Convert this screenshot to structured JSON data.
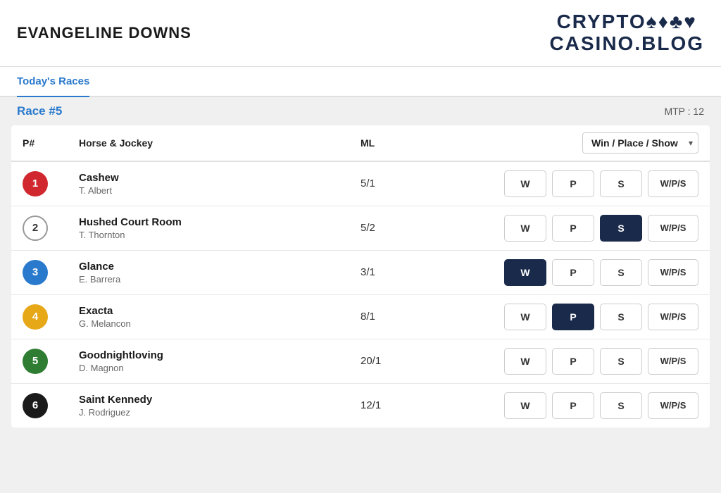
{
  "header": {
    "venue": "EVANGELINE DOWNS",
    "logo_line1": "CRYPTO♠♦♣♥",
    "logo_line2": "CASINO.BLOG"
  },
  "nav": {
    "today_races": "Today's Races"
  },
  "race": {
    "label": "Race #5",
    "mtp_label": "MTP : 12"
  },
  "table": {
    "col_p": "P#",
    "col_horse": "Horse & Jockey",
    "col_ml": "ML",
    "bet_type": "Win / Place / Show",
    "dropdown_chevron": "▾"
  },
  "horses": [
    {
      "number": "1",
      "color": "red",
      "outlined": false,
      "name": "Cashew",
      "jockey": "T. Albert",
      "ml": "5/1",
      "bets": [
        {
          "label": "W",
          "active": false
        },
        {
          "label": "P",
          "active": false
        },
        {
          "label": "S",
          "active": false
        },
        {
          "label": "W/P/S",
          "active": false
        }
      ]
    },
    {
      "number": "2",
      "color": "outlined",
      "outlined": true,
      "name": "Hushed Court Room",
      "jockey": "T. Thornton",
      "ml": "5/2",
      "bets": [
        {
          "label": "W",
          "active": false
        },
        {
          "label": "P",
          "active": false
        },
        {
          "label": "S",
          "active": true
        },
        {
          "label": "W/P/S",
          "active": false
        }
      ]
    },
    {
      "number": "3",
      "color": "blue",
      "outlined": false,
      "name": "Glance",
      "jockey": "E. Barrera",
      "ml": "3/1",
      "bets": [
        {
          "label": "W",
          "active": true
        },
        {
          "label": "P",
          "active": false
        },
        {
          "label": "S",
          "active": false
        },
        {
          "label": "W/P/S",
          "active": false
        }
      ]
    },
    {
      "number": "4",
      "color": "yellow",
      "outlined": false,
      "name": "Exacta",
      "jockey": "G. Melancon",
      "ml": "8/1",
      "bets": [
        {
          "label": "W",
          "active": false
        },
        {
          "label": "P",
          "active": true
        },
        {
          "label": "S",
          "active": false
        },
        {
          "label": "W/P/S",
          "active": false
        }
      ]
    },
    {
      "number": "5",
      "color": "green",
      "outlined": false,
      "name": "Goodnightloving",
      "jockey": "D. Magnon",
      "ml": "20/1",
      "bets": [
        {
          "label": "W",
          "active": false
        },
        {
          "label": "P",
          "active": false
        },
        {
          "label": "S",
          "active": false
        },
        {
          "label": "W/P/S",
          "active": false
        }
      ]
    },
    {
      "number": "6",
      "color": "dark",
      "outlined": false,
      "name": "Saint Kennedy",
      "jockey": "J. Rodriguez",
      "ml": "12/1",
      "bets": [
        {
          "label": "W",
          "active": false
        },
        {
          "label": "P",
          "active": false
        },
        {
          "label": "S",
          "active": false
        },
        {
          "label": "W/P/S",
          "active": false
        }
      ]
    }
  ]
}
